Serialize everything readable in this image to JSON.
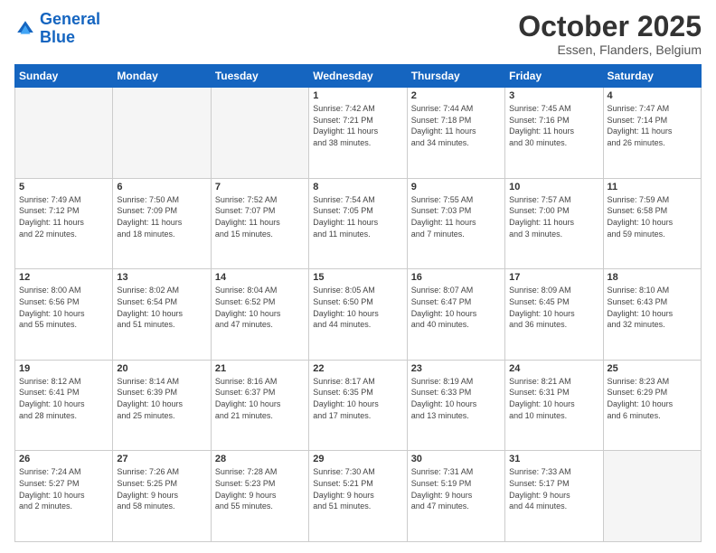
{
  "header": {
    "logo_line1": "General",
    "logo_line2": "Blue",
    "month": "October 2025",
    "location": "Essen, Flanders, Belgium"
  },
  "days_of_week": [
    "Sunday",
    "Monday",
    "Tuesday",
    "Wednesday",
    "Thursday",
    "Friday",
    "Saturday"
  ],
  "weeks": [
    [
      {
        "day": "",
        "info": ""
      },
      {
        "day": "",
        "info": ""
      },
      {
        "day": "",
        "info": ""
      },
      {
        "day": "1",
        "info": "Sunrise: 7:42 AM\nSunset: 7:21 PM\nDaylight: 11 hours\nand 38 minutes."
      },
      {
        "day": "2",
        "info": "Sunrise: 7:44 AM\nSunset: 7:18 PM\nDaylight: 11 hours\nand 34 minutes."
      },
      {
        "day": "3",
        "info": "Sunrise: 7:45 AM\nSunset: 7:16 PM\nDaylight: 11 hours\nand 30 minutes."
      },
      {
        "day": "4",
        "info": "Sunrise: 7:47 AM\nSunset: 7:14 PM\nDaylight: 11 hours\nand 26 minutes."
      }
    ],
    [
      {
        "day": "5",
        "info": "Sunrise: 7:49 AM\nSunset: 7:12 PM\nDaylight: 11 hours\nand 22 minutes."
      },
      {
        "day": "6",
        "info": "Sunrise: 7:50 AM\nSunset: 7:09 PM\nDaylight: 11 hours\nand 18 minutes."
      },
      {
        "day": "7",
        "info": "Sunrise: 7:52 AM\nSunset: 7:07 PM\nDaylight: 11 hours\nand 15 minutes."
      },
      {
        "day": "8",
        "info": "Sunrise: 7:54 AM\nSunset: 7:05 PM\nDaylight: 11 hours\nand 11 minutes."
      },
      {
        "day": "9",
        "info": "Sunrise: 7:55 AM\nSunset: 7:03 PM\nDaylight: 11 hours\nand 7 minutes."
      },
      {
        "day": "10",
        "info": "Sunrise: 7:57 AM\nSunset: 7:00 PM\nDaylight: 11 hours\nand 3 minutes."
      },
      {
        "day": "11",
        "info": "Sunrise: 7:59 AM\nSunset: 6:58 PM\nDaylight: 10 hours\nand 59 minutes."
      }
    ],
    [
      {
        "day": "12",
        "info": "Sunrise: 8:00 AM\nSunset: 6:56 PM\nDaylight: 10 hours\nand 55 minutes."
      },
      {
        "day": "13",
        "info": "Sunrise: 8:02 AM\nSunset: 6:54 PM\nDaylight: 10 hours\nand 51 minutes."
      },
      {
        "day": "14",
        "info": "Sunrise: 8:04 AM\nSunset: 6:52 PM\nDaylight: 10 hours\nand 47 minutes."
      },
      {
        "day": "15",
        "info": "Sunrise: 8:05 AM\nSunset: 6:50 PM\nDaylight: 10 hours\nand 44 minutes."
      },
      {
        "day": "16",
        "info": "Sunrise: 8:07 AM\nSunset: 6:47 PM\nDaylight: 10 hours\nand 40 minutes."
      },
      {
        "day": "17",
        "info": "Sunrise: 8:09 AM\nSunset: 6:45 PM\nDaylight: 10 hours\nand 36 minutes."
      },
      {
        "day": "18",
        "info": "Sunrise: 8:10 AM\nSunset: 6:43 PM\nDaylight: 10 hours\nand 32 minutes."
      }
    ],
    [
      {
        "day": "19",
        "info": "Sunrise: 8:12 AM\nSunset: 6:41 PM\nDaylight: 10 hours\nand 28 minutes."
      },
      {
        "day": "20",
        "info": "Sunrise: 8:14 AM\nSunset: 6:39 PM\nDaylight: 10 hours\nand 25 minutes."
      },
      {
        "day": "21",
        "info": "Sunrise: 8:16 AM\nSunset: 6:37 PM\nDaylight: 10 hours\nand 21 minutes."
      },
      {
        "day": "22",
        "info": "Sunrise: 8:17 AM\nSunset: 6:35 PM\nDaylight: 10 hours\nand 17 minutes."
      },
      {
        "day": "23",
        "info": "Sunrise: 8:19 AM\nSunset: 6:33 PM\nDaylight: 10 hours\nand 13 minutes."
      },
      {
        "day": "24",
        "info": "Sunrise: 8:21 AM\nSunset: 6:31 PM\nDaylight: 10 hours\nand 10 minutes."
      },
      {
        "day": "25",
        "info": "Sunrise: 8:23 AM\nSunset: 6:29 PM\nDaylight: 10 hours\nand 6 minutes."
      }
    ],
    [
      {
        "day": "26",
        "info": "Sunrise: 7:24 AM\nSunset: 5:27 PM\nDaylight: 10 hours\nand 2 minutes."
      },
      {
        "day": "27",
        "info": "Sunrise: 7:26 AM\nSunset: 5:25 PM\nDaylight: 9 hours\nand 58 minutes."
      },
      {
        "day": "28",
        "info": "Sunrise: 7:28 AM\nSunset: 5:23 PM\nDaylight: 9 hours\nand 55 minutes."
      },
      {
        "day": "29",
        "info": "Sunrise: 7:30 AM\nSunset: 5:21 PM\nDaylight: 9 hours\nand 51 minutes."
      },
      {
        "day": "30",
        "info": "Sunrise: 7:31 AM\nSunset: 5:19 PM\nDaylight: 9 hours\nand 47 minutes."
      },
      {
        "day": "31",
        "info": "Sunrise: 7:33 AM\nSunset: 5:17 PM\nDaylight: 9 hours\nand 44 minutes."
      },
      {
        "day": "",
        "info": ""
      }
    ]
  ]
}
